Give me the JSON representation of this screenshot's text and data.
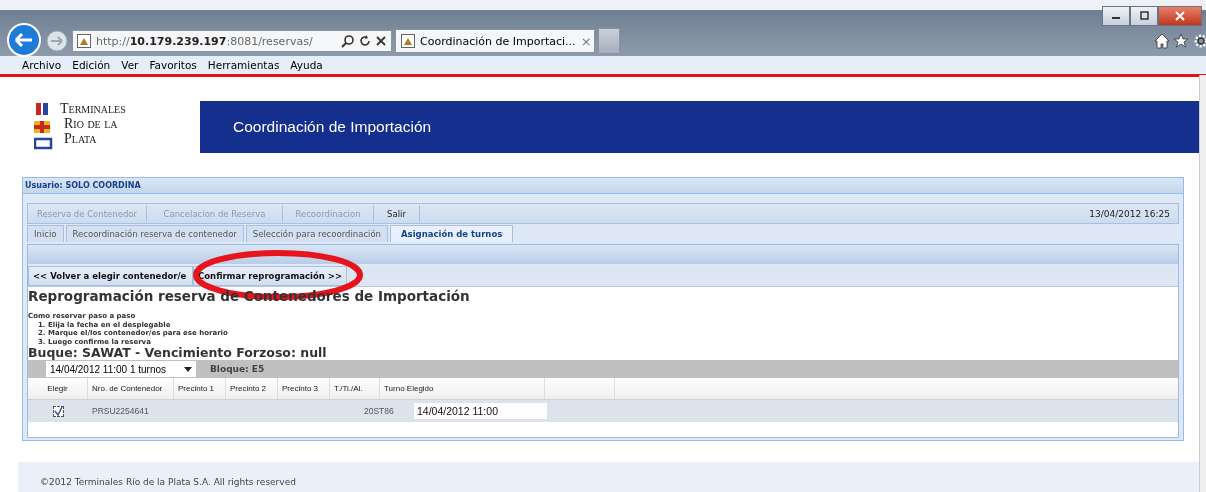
{
  "browser": {
    "address": {
      "prefix": "http://",
      "host": "10.179.239.197",
      "rest": ":8081/reservas/"
    },
    "tab": {
      "title": "Coordinación de Importaci...",
      "close": "×"
    },
    "menu": [
      "Archivo",
      "Edición",
      "Ver",
      "Favoritos",
      "Herramientas",
      "Ayuda"
    ]
  },
  "header": {
    "logo": [
      "Terminales",
      "Rio de la",
      "Plata"
    ],
    "title": "Coordinación de Importación"
  },
  "panel": {
    "user": "Usuario: SOLO COORDINA",
    "date": "13/04/2012 16:25",
    "menu": [
      {
        "label": "Reserva de Contenedor",
        "disabled": true
      },
      {
        "label": "Cancelacion de Reserva",
        "disabled": true
      },
      {
        "label": "Recoordinacion",
        "disabled": true
      },
      {
        "label": "Salir",
        "disabled": false
      }
    ],
    "tabs": [
      {
        "label": "Inicio",
        "selected": false
      },
      {
        "label": "Recoordinación reserva de contenedor",
        "selected": false
      },
      {
        "label": "Selección para recoordinación",
        "selected": false
      },
      {
        "label": "Asignación de turnos",
        "selected": true
      }
    ],
    "actions": [
      "<< Volver a elegir contenedor/e",
      "Confirmar reprogramación >>"
    ],
    "heading": "Reprogramación reserva de Contenedores de Importación",
    "steps_title": "Como reservar paso a paso",
    "steps": [
      "1. Elija la fecha en el desplegable",
      "2. Marque el/los contenedor/es para ese horario",
      "3. Luego confirme la reserva"
    ],
    "ship": "Buque: SAWAT - Vencimiento Forzoso: null",
    "slot_select": "14/04/2012 11:00 1 turnos",
    "block": "Bloque: E5",
    "table": {
      "columns": [
        "Elegir",
        "Nro. de Contenedor",
        "Precinto 1",
        "Precinto 2",
        "Precinto 3",
        "T./Ti./Al.",
        "Turno Elegido"
      ],
      "rows": [
        {
          "checked": true,
          "container": "PRSU2254641",
          "type": "20ST86",
          "turn": "14/04/2012 11:00"
        }
      ]
    }
  },
  "footer": "©2012 Terminales Río de la Plata S.A. All rights reserved",
  "annotation": {
    "kind": "ellipse",
    "color": "#e8141b"
  }
}
